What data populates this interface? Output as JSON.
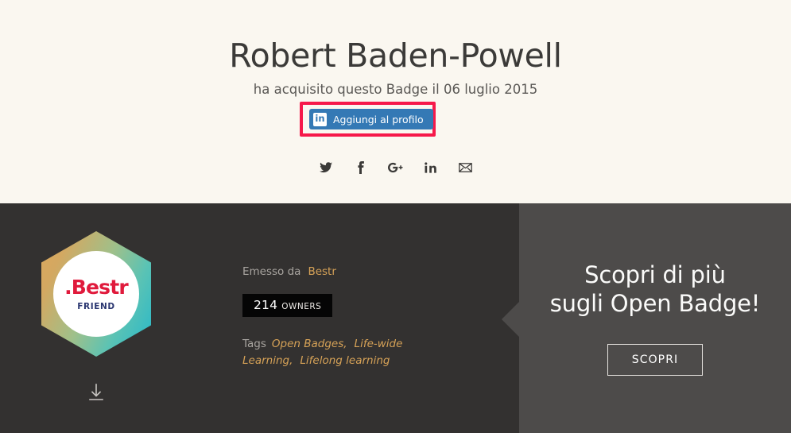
{
  "hero": {
    "recipient_name": "Robert Baden-Powell",
    "acquired_text": "ha acquisito questo Badge il 06 luglio 2015",
    "linkedin_button": {
      "label": "Aggiungi al profilo",
      "mark": "in",
      "bg_color": "#3479b5",
      "highlight_color": "#f6194a"
    },
    "background_color": "#faf7f0",
    "social": [
      {
        "name": "twitter-icon",
        "title": "Twitter"
      },
      {
        "name": "facebook-icon",
        "title": "Facebook"
      },
      {
        "name": "google-plus-icon",
        "title": "Google+"
      },
      {
        "name": "linkedin-icon",
        "title": "LinkedIn"
      },
      {
        "name": "email-icon",
        "title": "Email"
      }
    ]
  },
  "badge": {
    "title_text": ".Bestr",
    "subtitle_text": "FRIEND",
    "title_color": "#e01a3c",
    "subtitle_color": "#2a3670",
    "gradient_from": "#dca85e",
    "gradient_mid": "#9fc08a",
    "gradient_to": "#25b7cb",
    "download_icon": "download-icon"
  },
  "meta": {
    "issued_label": "Emesso da",
    "issuer": "Bestr",
    "owners_count": "214",
    "owners_word": "OWNERS",
    "tags_label": "Tags",
    "tags": [
      "Open Badges,",
      "Life-wide Learning,",
      "Lifelong learning"
    ],
    "accent_color": "#d6a257",
    "panel_color": "#333130"
  },
  "promo": {
    "title_line_1": "Scopri di più",
    "title_line_2": "sugli Open Badge!",
    "button_label": "SCOPRI",
    "panel_color": "#4d4b4a"
  }
}
